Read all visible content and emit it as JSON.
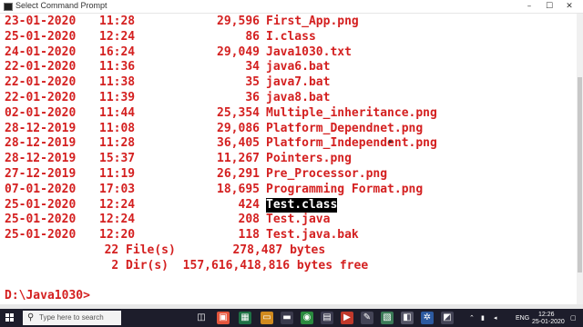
{
  "window": {
    "title": "Select Command Prompt",
    "minimize_icon": "–",
    "maximize_icon": "☐",
    "close_icon": "✕"
  },
  "listing": [
    {
      "date": "23-01-2020",
      "time": "11:28",
      "size": "29,596",
      "name": "First_App.png"
    },
    {
      "date": "25-01-2020",
      "time": "12:24",
      "size": "86",
      "name": "I.class"
    },
    {
      "date": "24-01-2020",
      "time": "16:24",
      "size": "29,049",
      "name": "Java1030.txt"
    },
    {
      "date": "22-01-2020",
      "time": "11:36",
      "size": "34",
      "name": "java6.bat"
    },
    {
      "date": "22-01-2020",
      "time": "11:38",
      "size": "35",
      "name": "java7.bat"
    },
    {
      "date": "22-01-2020",
      "time": "11:39",
      "size": "36",
      "name": "java8.bat"
    },
    {
      "date": "02-01-2020",
      "time": "11:44",
      "size": "25,354",
      "name": "Multiple_inheritance.png"
    },
    {
      "date": "28-12-2019",
      "time": "11:08",
      "size": "29,086",
      "name": "Platform_Dependnet.png"
    },
    {
      "date": "28-12-2019",
      "time": "11:28",
      "size": "36,405",
      "name": "Platform_Independent.png"
    },
    {
      "date": "28-12-2019",
      "time": "15:37",
      "size": "11,267",
      "name": "Pointers.png"
    },
    {
      "date": "27-12-2019",
      "time": "11:19",
      "size": "26,291",
      "name": "Pre_Processor.png"
    },
    {
      "date": "07-01-2020",
      "time": "17:03",
      "size": "18,695",
      "name": "Programming Format.png"
    },
    {
      "date": "25-01-2020",
      "time": "12:24",
      "size": "424",
      "name": "Test.class",
      "highlighted": true
    },
    {
      "date": "25-01-2020",
      "time": "12:24",
      "size": "208",
      "name": "Test.java"
    },
    {
      "date": "25-01-2020",
      "time": "12:20",
      "size": "118",
      "name": "Test.java.bak"
    }
  ],
  "summary": {
    "files": "              22 File(s)        278,487 bytes",
    "dirs": "               2 Dir(s)  157,616,418,816 bytes free"
  },
  "prompt": "D:\\Java1030>",
  "taskbar": {
    "search_placeholder": "Type here to search",
    "language": "ENG",
    "time": "12:26",
    "date": "25-01-2020"
  },
  "colors": {
    "console_text": "#d42020",
    "console_bg": "#ffffff",
    "highlight_bg": "#000000",
    "highlight_fg": "#ffffff",
    "taskbar_bg": "#1d1d2b"
  }
}
